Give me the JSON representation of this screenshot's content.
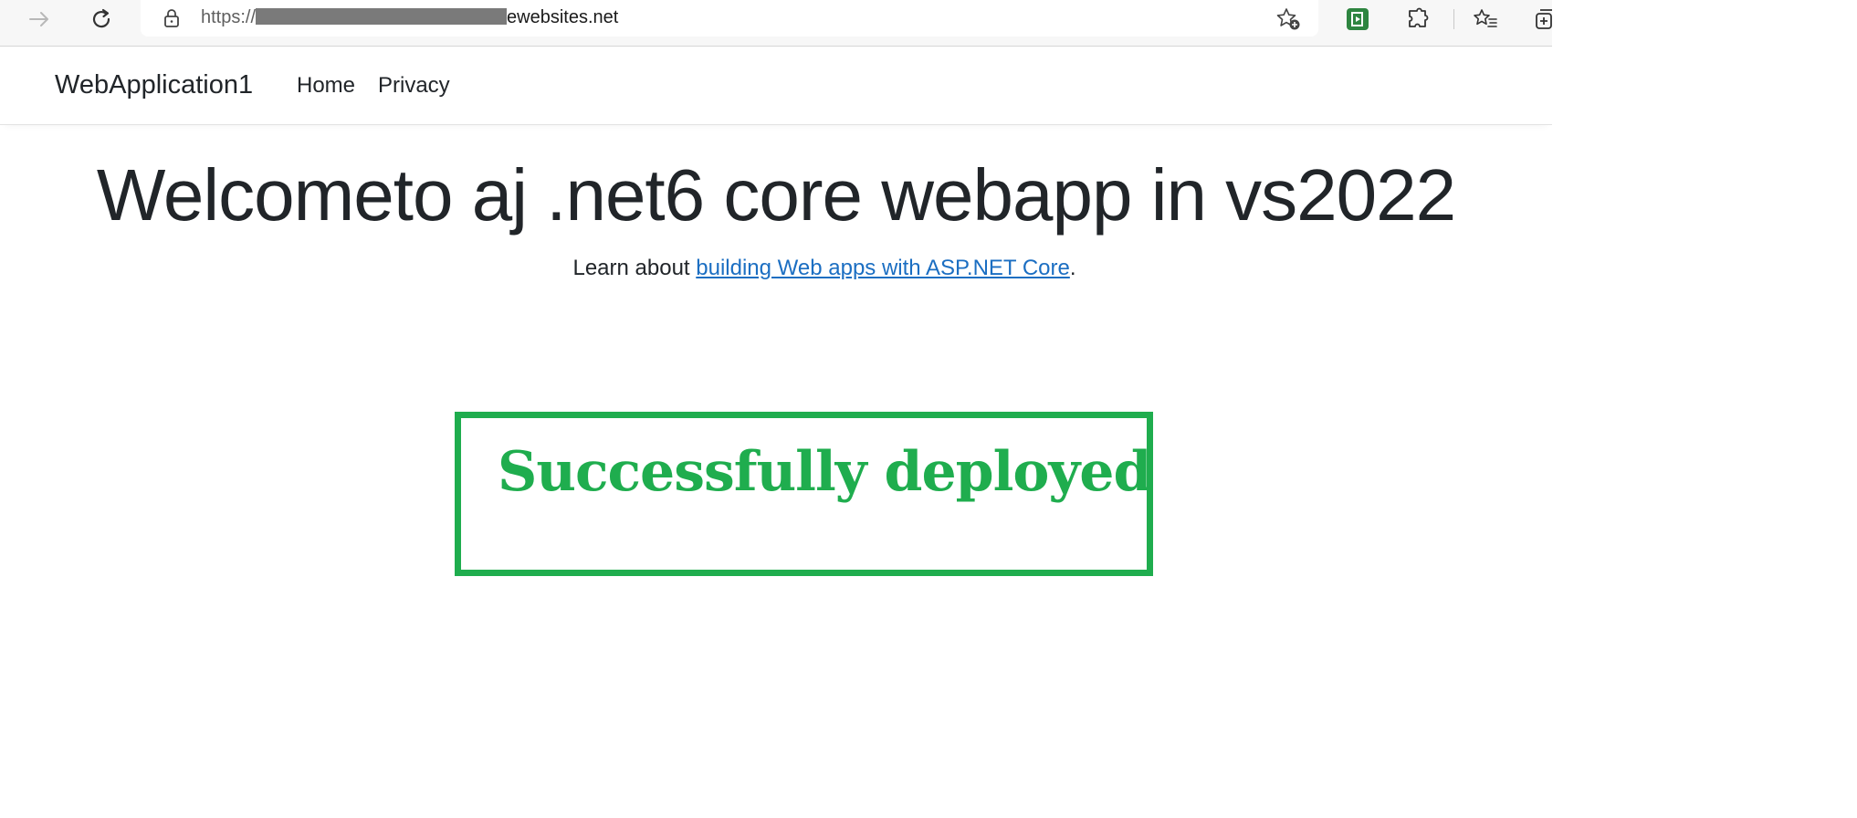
{
  "browser": {
    "url_prefix": "https://",
    "url_suffix": "ewebsites.net",
    "toolbar_icons": [
      "forward-icon",
      "refresh-icon",
      "lock-icon",
      "add-favorite-icon",
      "extension-app-icon",
      "extensions-icon",
      "favorites-icon",
      "collections-icon"
    ]
  },
  "navbar": {
    "brand": "WebApplication1",
    "links": [
      {
        "label": "Home"
      },
      {
        "label": "Privacy"
      }
    ]
  },
  "main": {
    "heading": "Welcometo aj .net6 core webapp in vs2022",
    "lead_prefix": "Learn about ",
    "lead_link": "building Web apps with ASP.NET Core",
    "lead_suffix": "."
  },
  "annotation": {
    "text": "Successfully deployed",
    "color": "#1fad4e"
  },
  "colors": {
    "link": "#1b6ec2",
    "text": "#212529",
    "accent_green": "#1fad4e"
  }
}
